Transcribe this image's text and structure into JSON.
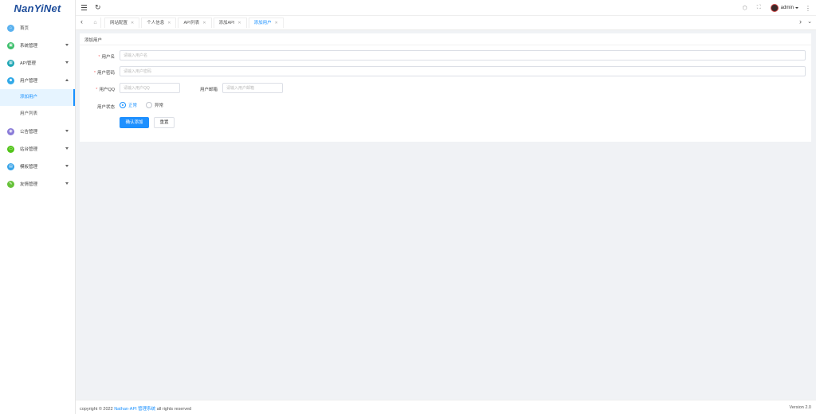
{
  "brand": {
    "logo_text": "NanYiNet"
  },
  "sidebar": {
    "items": [
      {
        "label": "首页",
        "icon": "home-icon",
        "color": "#5ab1ef",
        "glyph": "⌂"
      },
      {
        "label": "系统管理",
        "icon": "settings-icon",
        "color": "#3cbf6b",
        "glyph": "▣"
      },
      {
        "label": "API管理",
        "icon": "api-icon",
        "color": "#1fa6b4",
        "glyph": "▦"
      },
      {
        "label": "用户管理",
        "icon": "user-icon",
        "color": "#31a9e8",
        "glyph": "☻",
        "expanded": true,
        "children": [
          {
            "label": "添加用户",
            "active": true
          },
          {
            "label": "用户列表",
            "active": false
          }
        ]
      },
      {
        "label": "公告管理",
        "icon": "notice-icon",
        "color": "#8a7bd8",
        "glyph": "◉"
      },
      {
        "label": "站台管理",
        "icon": "station-icon",
        "color": "#52c41a",
        "glyph": "▭"
      },
      {
        "label": "模板管理",
        "icon": "template-icon",
        "color": "#36a3e8",
        "glyph": "▤"
      },
      {
        "label": "友情管理",
        "icon": "link-icon",
        "color": "#67c23a",
        "glyph": "✎"
      }
    ]
  },
  "header": {
    "user": "admin",
    "refresh_glyph": "↻",
    "tag_glyph": "⬡",
    "fullscreen_glyph": "⛶",
    "more_glyph": "⋮"
  },
  "tabs": [
    {
      "label": "网站配置",
      "active": false
    },
    {
      "label": "个人信息",
      "active": false
    },
    {
      "label": "API列表",
      "active": false
    },
    {
      "label": "添加API",
      "active": false
    },
    {
      "label": "添加用户",
      "active": true
    }
  ],
  "form": {
    "title": "添加用户",
    "username_label": "用户名",
    "username_placeholder": "请输入用户名",
    "password_label": "用户密码",
    "password_placeholder": "请输入用户密码",
    "qq_label": "用户QQ",
    "qq_placeholder": "请输入用户QQ",
    "email_label": "用户邮箱",
    "email_placeholder": "请输入用户邮箱",
    "status_label": "用户状态",
    "status_options": [
      {
        "label": "正常",
        "checked": true
      },
      {
        "label": "异常",
        "checked": false
      }
    ],
    "submit_label": "确认添加",
    "reset_label": "重置"
  },
  "footer": {
    "prefix": "copyright © 2022",
    "link": "Nathan·API 管理系统",
    "suffix": "all rights reserved",
    "version": "Version 2.0"
  },
  "colors": {
    "accent": "#1890ff",
    "required": "#f56c6c"
  }
}
